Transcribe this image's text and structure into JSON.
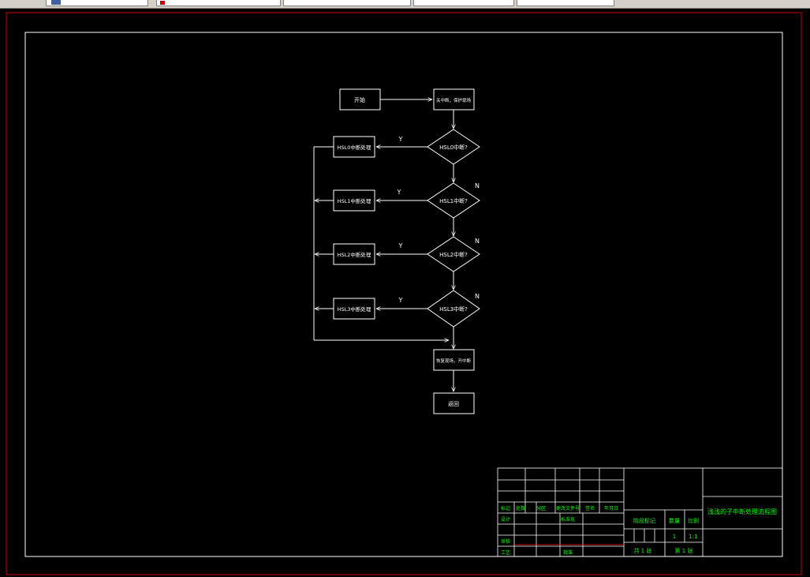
{
  "app": {
    "toolbar_fields": [
      {
        "kind": "layer",
        "label": ""
      },
      {
        "kind": "color",
        "label": ""
      },
      {
        "kind": "linetype",
        "label": ""
      },
      {
        "kind": "lineweight",
        "label": ""
      },
      {
        "kind": "plotstyle",
        "label": ""
      }
    ],
    "colors": {
      "background": "#000000",
      "sheet_border": "#cc0000",
      "linework": "#ffffff",
      "title_block_text": "#00ff00",
      "title_block_redline": "#ff0000"
    }
  },
  "flowchart": {
    "start": "开始",
    "init": "关中断，保护现场",
    "decisions": [
      "HSL0中断?",
      "HSL1中断?",
      "HSL2中断?",
      "HSL3中断?"
    ],
    "handlers": [
      "HSL0中断处理",
      "HSL1中断处理",
      "HSL2中断处理",
      "HSL3中断处理"
    ],
    "yes_label": "Y",
    "no_label": "N",
    "restore": "恢复现场，开中断",
    "end": "返回"
  },
  "title_block": {
    "drawing_title": "浅浅的子中断处理流程图",
    "header_row": [
      "标记",
      "处数",
      "分区",
      "更改文件号",
      "签名",
      "年月日"
    ],
    "row_design": [
      "设计",
      "",
      "",
      "标准化",
      "",
      ""
    ],
    "row_review": "审核",
    "row_process": "工艺",
    "row_approve": "批准",
    "stage_label": "阶段标记",
    "weight_label": "数量",
    "scale_label": "比例",
    "weight_value": "1",
    "scale_value": "1:1",
    "sheets_total": "共 1 张",
    "sheet_no": "第 1 张"
  }
}
